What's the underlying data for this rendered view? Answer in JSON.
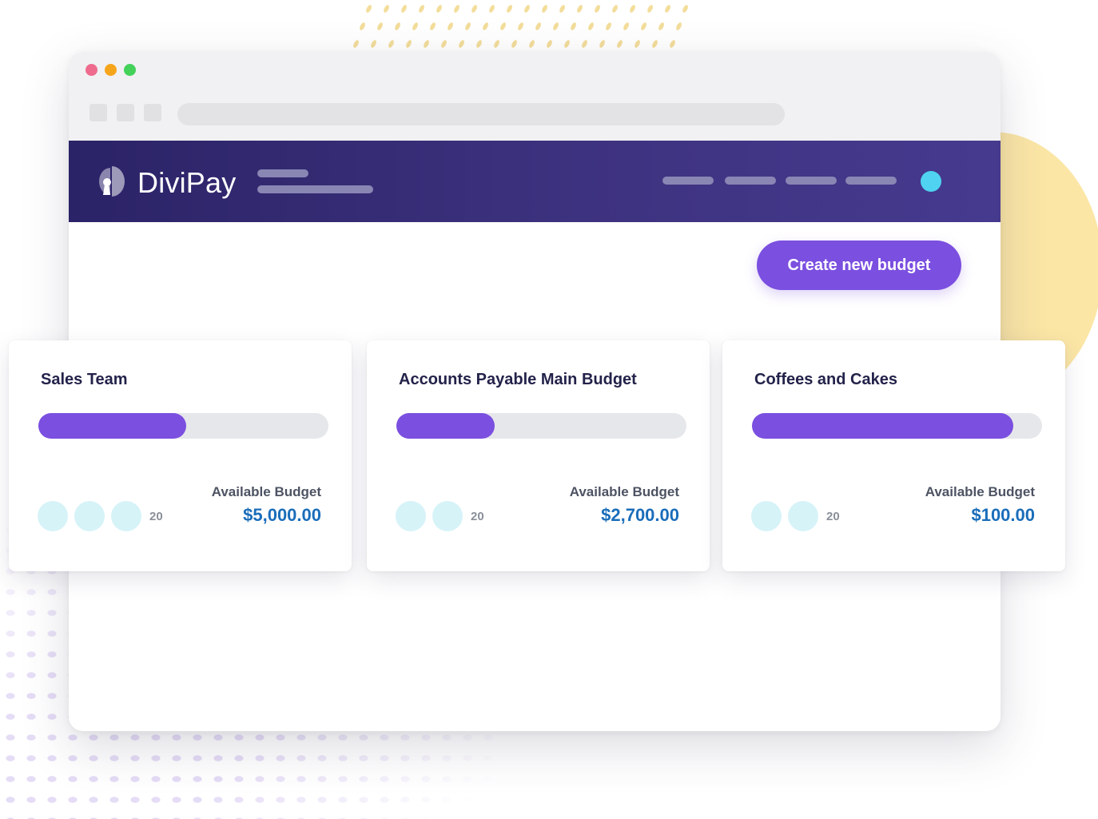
{
  "app": {
    "brand": "DiviPay",
    "create_button_label": "Create new budget"
  },
  "colors": {
    "header_gradient_start": "#2b2367",
    "header_gradient_end": "#463a8f",
    "accent": "#7b4fe0",
    "amount": "#1a6dba",
    "avatar": "#4fd3f0",
    "icon_bg": "#d6f3f8"
  },
  "budgets": [
    {
      "name": "Sales Team",
      "progress_fraction": 0.51,
      "icons": [
        "card-icon",
        "receipt-icon",
        "user-icon"
      ],
      "member_count": "20",
      "available_label": "Available Budget",
      "available_amount": "$5,000.00"
    },
    {
      "name": "Accounts Payable Main Budget",
      "progress_fraction": 0.34,
      "icons": [
        "card-icon",
        "user-icon"
      ],
      "member_count": "20",
      "available_label": "Available Budget",
      "available_amount": "$2,700.00"
    },
    {
      "name": "Coffees and Cakes",
      "progress_fraction": 0.9,
      "icons": [
        "card-icon",
        "user-icon"
      ],
      "member_count": "20",
      "available_label": "Available Budget",
      "available_amount": "$100.00"
    }
  ]
}
